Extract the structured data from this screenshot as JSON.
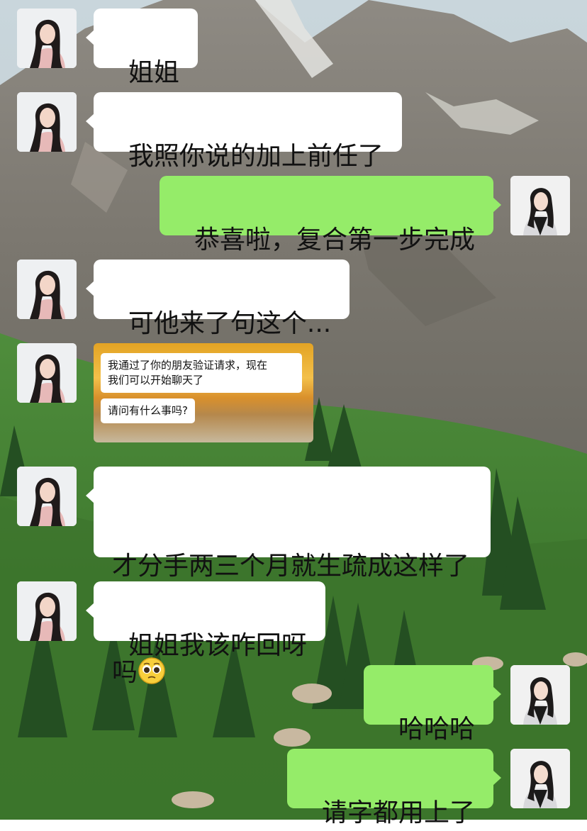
{
  "messages": [
    {
      "side": "in",
      "text": "姐姐"
    },
    {
      "side": "in",
      "text": "我照你说的加上前任了"
    },
    {
      "side": "out",
      "text": "恭喜啦，复合第一步完成"
    },
    {
      "side": "in",
      "text": "可他来了句这个..."
    },
    {
      "side": "in",
      "type": "image",
      "shot": {
        "line1": "我通过了你的朋友验证请求，现在",
        "line2": "我们可以开始聊天了",
        "line3": "请问有什么事吗?"
      }
    },
    {
      "side": "in",
      "text": "才分手两三个月就生疏成这样了",
      "text2": "吗",
      "emoji": "pleading-face"
    },
    {
      "side": "in",
      "text": "姐姐我该咋回呀"
    },
    {
      "side": "out",
      "text": "哈哈哈"
    },
    {
      "side": "out",
      "text": "请字都用上了"
    }
  ],
  "colors": {
    "outgoing_bubble": "#95ec69",
    "incoming_bubble": "#ffffff"
  }
}
